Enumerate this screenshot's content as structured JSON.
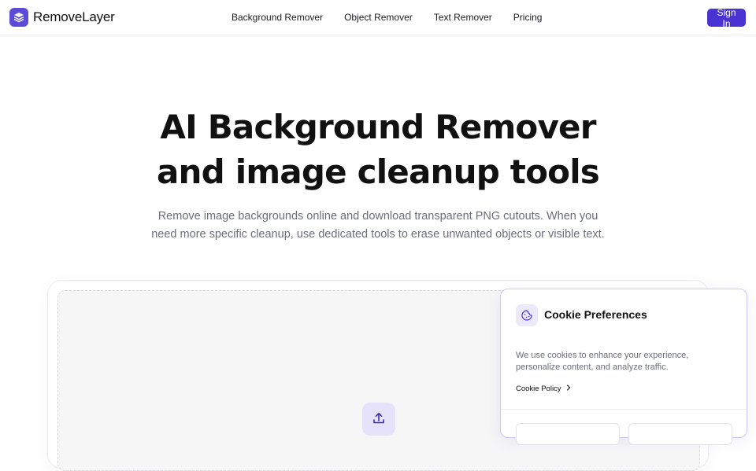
{
  "header": {
    "brand_name": "RemoveLayer",
    "brand_icon": "layers-icon",
    "nav": [
      {
        "label": "Background Remover"
      },
      {
        "label": "Object Remover"
      },
      {
        "label": "Text Remover"
      },
      {
        "label": "Pricing"
      }
    ],
    "signin_label": "Sign In"
  },
  "hero": {
    "title_line1": "AI Background Remover",
    "title_line2": "and image cleanup tools",
    "subtitle_line1": "Remove image backgrounds online and download transparent PNG cutouts. When you",
    "subtitle_line2": "need more specific cleanup, use dedicated tools to erase unwanted objects or visible text."
  },
  "upload": {
    "icon": "upload-icon"
  },
  "cookie": {
    "icon": "cookie-icon",
    "title": "Cookie Preferences",
    "text": "We use cookies to enhance your experience, personalize content, and analyze traffic.",
    "policy_link": "Cookie Policy"
  },
  "colors": {
    "accent": "#4a33d3",
    "brand_logo": "#5b4bd8",
    "upload_tint": "#e6e2fb",
    "cookie_border": "#cfc6f7",
    "muted_text": "#6b6e78"
  }
}
